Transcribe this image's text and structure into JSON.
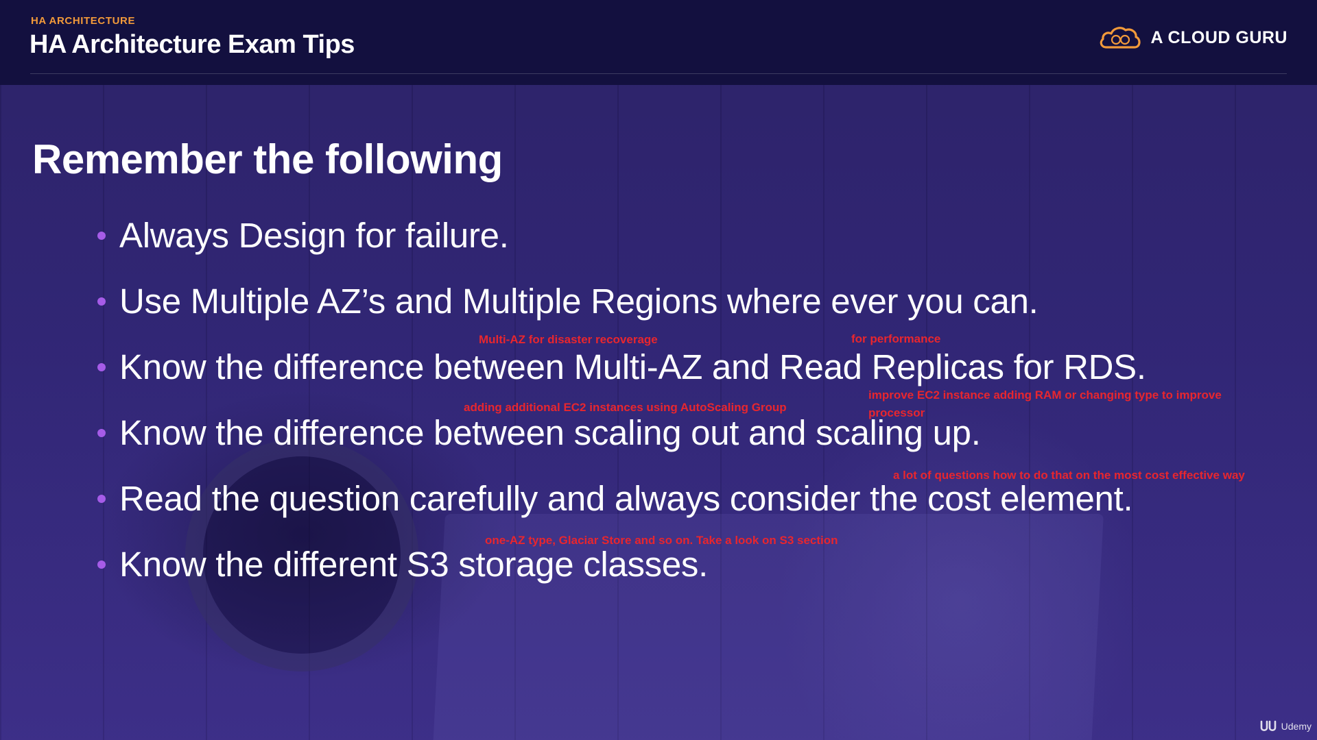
{
  "header": {
    "eyebrow": "HA ARCHITECTURE",
    "title": "HA Architecture Exam Tips",
    "brand": "A CLOUD GURU"
  },
  "content": {
    "heading": "Remember the following",
    "bullets": [
      "Always Design for failure.",
      "Use Multiple AZ’s and Multiple Regions where ever you can.",
      "Know the difference between Multi-AZ and Read Replicas for RDS.",
      "Know the difference between scaling out and scaling up.",
      "Read the question carefully and always consider the cost element.",
      "Know the different S3 storage classes."
    ]
  },
  "annotations": {
    "multi_az": "Multi-AZ for disaster recoverage",
    "read_replicas": "for performance",
    "scaling_out": "adding additional EC2 instances using AutoScaling Group",
    "scaling_up": "improve EC2 instance adding RAM or changing type to improve processor",
    "cost": "a lot of questions how to do that on the most cost effective way",
    "s3": "one-AZ type, Glaciar Store and so on. Take a look on S3 section"
  },
  "watermark": "Udemy",
  "icons": {
    "brand_logo": "cloud-logo-icon",
    "watermark_logo": "udemy-logo-icon"
  },
  "colors": {
    "header_bg": "#13103f",
    "eyebrow": "#f29a3a",
    "bullet_dot": "#a65ce8",
    "annotation": "#e8262e"
  }
}
